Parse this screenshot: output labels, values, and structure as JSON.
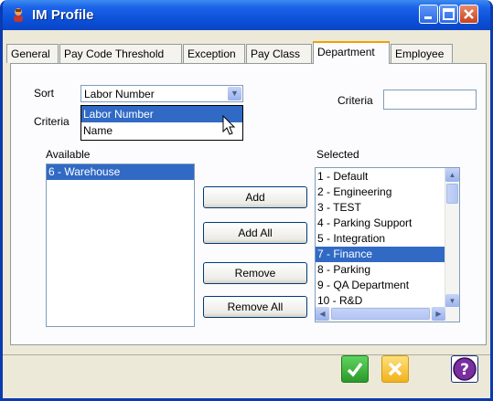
{
  "window": {
    "title": "IM Profile",
    "icon": "user-profile-icon"
  },
  "tabs": [
    {
      "label": "General"
    },
    {
      "label": "Pay Code Threshold"
    },
    {
      "label": "Exception"
    },
    {
      "label": "Pay Class"
    },
    {
      "label": "Department",
      "active": true
    },
    {
      "label": "Employee"
    }
  ],
  "sort": {
    "label": "Sort",
    "selected": "Labor Number",
    "options": [
      "Labor Number",
      "Name"
    ],
    "highlighted_option": "Labor Number"
  },
  "left_criteria_label": "Criteria",
  "right_criteria": {
    "label": "Criteria",
    "value": ""
  },
  "available": {
    "label": "Available",
    "items": [
      "6 - Warehouse"
    ],
    "selected_item": "6 - Warehouse"
  },
  "selected": {
    "label": "Selected",
    "items": [
      "1 - Default",
      "2 - Engineering",
      "3 - TEST",
      "4 - Parking Support",
      "5 - Integration",
      "7 - Finance",
      "8 - Parking",
      "9 - QA Department",
      "10 - R&D"
    ],
    "selected_item": "7 - Finance"
  },
  "buttons": {
    "add": "Add",
    "add_all": "Add All",
    "remove": "Remove",
    "remove_all": "Remove All"
  },
  "footer": {
    "ok_icon": "checkmark-icon",
    "cancel_icon": "x-icon",
    "help_icon": "question-mark-icon"
  },
  "colors": {
    "titlebar": "#0a4fd6",
    "selection": "#316ac5",
    "ok": "#3bb33b",
    "cancel": "#f6c53a",
    "help": "#7a2fa0"
  }
}
